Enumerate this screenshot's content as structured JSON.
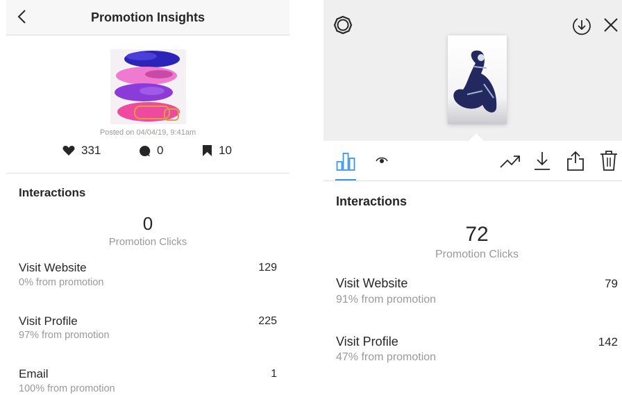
{
  "left": {
    "header": {
      "title": "Promotion Insights"
    },
    "post": {
      "posted_text": "Posted on 04/04/19, 9:41am",
      "likes": "331",
      "comments": "0",
      "saves": "10"
    },
    "interactions": {
      "heading": "Interactions",
      "promotion_clicks_value": "0",
      "promotion_clicks_label": "Promotion Clicks",
      "rows": [
        {
          "title": "Visit Website",
          "sub": "0% from promotion",
          "value": "129"
        },
        {
          "title": "Visit Profile",
          "sub": "97% from promotion",
          "value": "225"
        },
        {
          "title": "Email",
          "sub": "100% from promotion",
          "value": "1"
        }
      ]
    }
  },
  "right": {
    "top_icons": [
      "settings-icon",
      "download-circle-icon",
      "close-icon"
    ],
    "toolbar_icons": [
      "bar-chart-icon",
      "eye-icon",
      "trending-icon",
      "download-icon",
      "share-icon",
      "trash-icon"
    ],
    "interactions": {
      "heading": "Interactions",
      "promotion_clicks_value": "72",
      "promotion_clicks_label": "Promotion Clicks",
      "rows": [
        {
          "title": "Visit Website",
          "sub": "91% from promotion",
          "value": "79"
        },
        {
          "title": "Visit Profile",
          "sub": "47% from promotion",
          "value": "142"
        }
      ]
    }
  },
  "colors": {
    "accent": "#3897f0",
    "text": "#262626",
    "muted": "#999999"
  }
}
